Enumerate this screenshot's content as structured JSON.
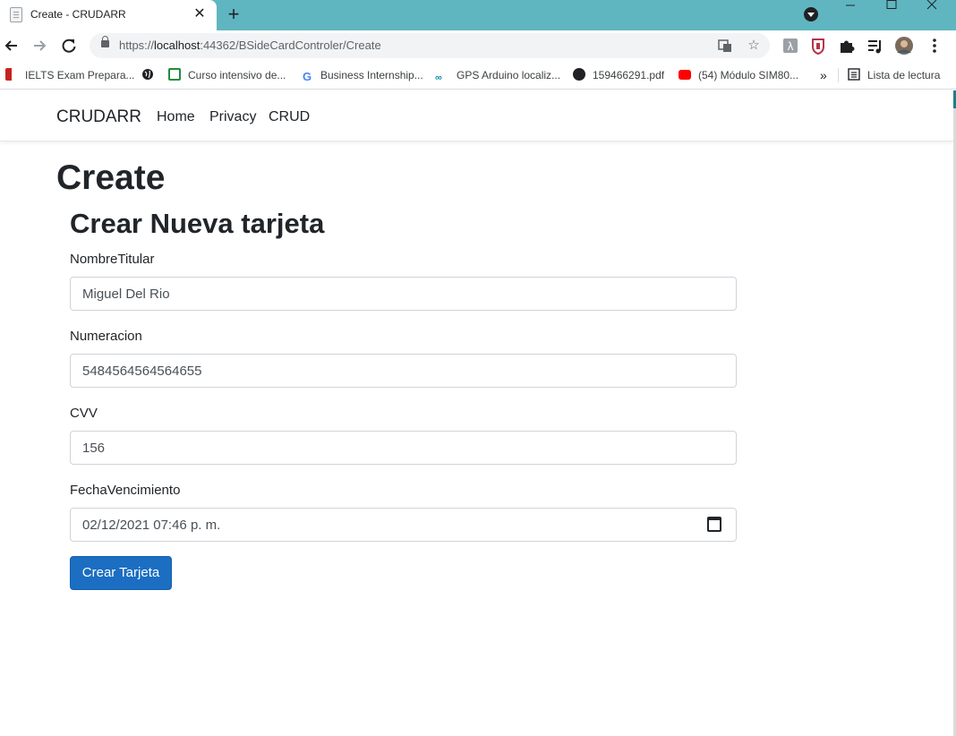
{
  "browser": {
    "tab_title": "Create - CRUDARR",
    "new_tab_symbol": "+",
    "url_prefix": "https://",
    "url_host": "localhost",
    "url_path": ":44362/BSideCardControler/Create",
    "bookmarks": [
      {
        "label": "IELTS Exam Prepara..."
      },
      {
        "label": "Curso intensivo de..."
      },
      {
        "label": "Business Internship..."
      },
      {
        "label": "GPS Arduino localiz..."
      },
      {
        "label": "159466291.pdf"
      },
      {
        "label": "(54) Módulo SIM80..."
      }
    ],
    "bookmarks_overflow": "»",
    "reading_list_label": "Lista de lectura"
  },
  "navbar": {
    "brand": "CRUDARR",
    "links": [
      "Home",
      "Privacy",
      "CRUD"
    ]
  },
  "main": {
    "page_title": "Create",
    "form_title": "Crear Nueva tarjeta",
    "fields": [
      {
        "label": "NombreTitular",
        "value": "Miguel Del Rio"
      },
      {
        "label": "Numeracion",
        "value": "5484564564564655"
      },
      {
        "label": "CVV",
        "value": "156"
      },
      {
        "label": "FechaVencimiento",
        "value": "02/12/2021 07:46 p. m."
      }
    ],
    "submit_label": "Crear Tarjeta"
  },
  "colors": {
    "tab_strip": "#5fb6c0",
    "primary_button": "#1b6ec2"
  }
}
